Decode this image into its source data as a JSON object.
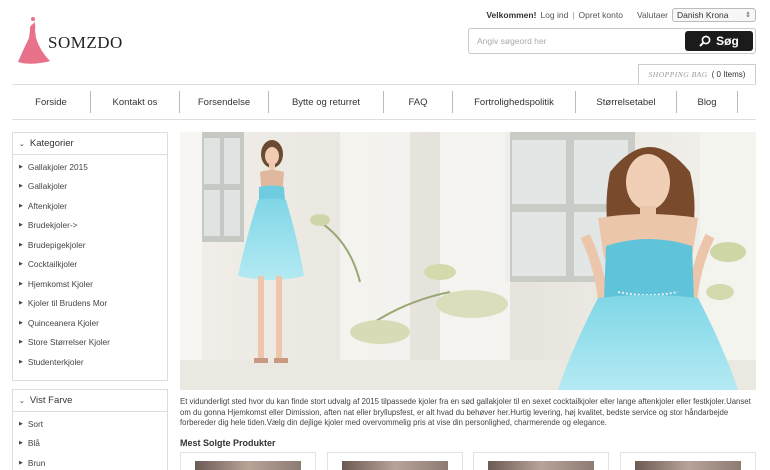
{
  "brand": {
    "name": "SOMZDO",
    "accent": "#e8728a"
  },
  "topbar": {
    "welcome": "Velkommen!",
    "login": "Log ind",
    "register": "Opret konto",
    "currency_label": "Valutaer",
    "currency_value": "Danish Krona"
  },
  "search": {
    "placeholder": "Angiv søgeord her",
    "button_label": "Søg",
    "button_icon": "magnifier-icon"
  },
  "cart": {
    "label": "SHOPPING BAG",
    "count": "( 0 Items)"
  },
  "nav": [
    {
      "label": "Forside"
    },
    {
      "label": "Kontakt os"
    },
    {
      "label": "Forsendelse"
    },
    {
      "label": "Bytte og returret"
    },
    {
      "label": "FAQ"
    },
    {
      "label": "Fortrolighedspolitik"
    },
    {
      "label": "Størrelsetabel"
    },
    {
      "label": "Blog"
    }
  ],
  "categories": {
    "title": "Kategorier",
    "items": [
      "Gallakjoler 2015",
      "Gallakjoler",
      "Aftenkjoler",
      "Brudekjoler->",
      "Brudepigekjoler",
      "Cocktailkjoler",
      "Hjemkomst Kjoler",
      "Kjoler til Brudens Mor",
      "Quinceanera Kjoler",
      "Store Størrelser Kjoler",
      "Studenterkjoler"
    ]
  },
  "colors": {
    "title": "Vist Farve",
    "items": [
      "Sort",
      "Blå",
      "Brun"
    ]
  },
  "description": "Et vidunderligt sted hvor du kan finde stort udvalg af 2015 tilpassede kjoler fra en sød gallakjoler til en sexet cocktailkjoler eller lange aftenkjoler eller festkjoler.Uanset om du gonna Hjemkomst eller Dimission, aften nat eller bryllupsfest, er alt hvad du behøver her.Hurtig levering, høj kvalitet, bedste service og stor håndarbejde forbereder dig hele tiden.Vælg din dejlige kjoler med overvommelig pris at vise din personlighed, charmerende og elegance.",
  "bestsellers": {
    "title": "Mest Solgte Produkter"
  }
}
